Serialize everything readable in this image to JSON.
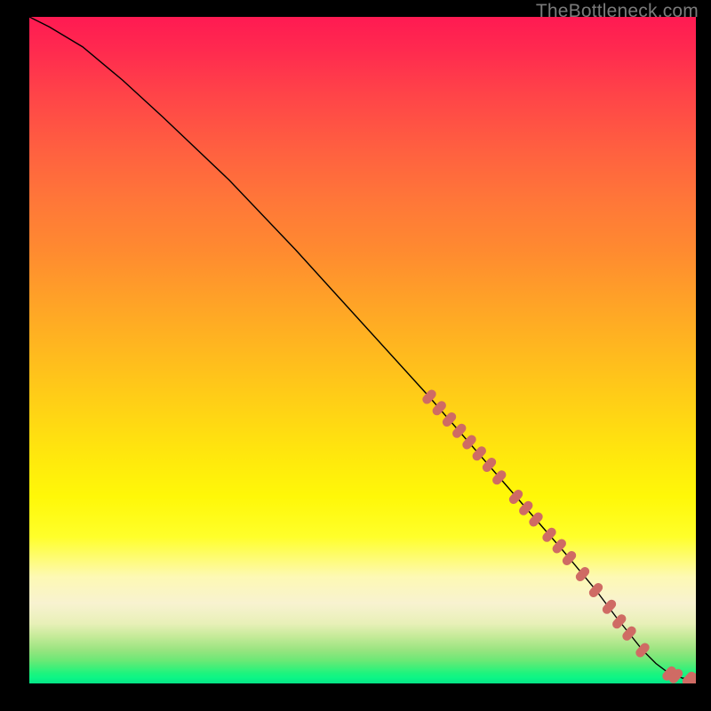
{
  "watermark": "TheBottleneck.com",
  "chart_data": {
    "type": "line",
    "title": "",
    "xlabel": "",
    "ylabel": "",
    "xlim": [
      0,
      100
    ],
    "ylim": [
      0,
      100
    ],
    "series": [
      {
        "name": "curve",
        "color": "#000000",
        "x": [
          0,
          3,
          8,
          14,
          20,
          30,
          40,
          50,
          60,
          70,
          80,
          85,
          88,
          90,
          92,
          94,
          96,
          98,
          100
        ],
        "y": [
          100,
          98.5,
          95.5,
          90.5,
          85,
          75.5,
          65,
          54,
          43,
          31.5,
          20,
          14,
          10,
          7.5,
          5,
          3,
          1.5,
          0.8,
          0.6
        ]
      }
    ],
    "markers": [
      {
        "x": 60,
        "y": 43,
        "color": "#cf6b64"
      },
      {
        "x": 61.5,
        "y": 41.3,
        "color": "#cf6b64"
      },
      {
        "x": 63,
        "y": 39.6,
        "color": "#cf6b64"
      },
      {
        "x": 64.5,
        "y": 37.9,
        "color": "#cf6b64"
      },
      {
        "x": 66,
        "y": 36.2,
        "color": "#cf6b64"
      },
      {
        "x": 67.5,
        "y": 34.5,
        "color": "#cf6b64"
      },
      {
        "x": 69,
        "y": 32.8,
        "color": "#cf6b64"
      },
      {
        "x": 70.5,
        "y": 30.9,
        "color": "#cf6b64"
      },
      {
        "x": 73,
        "y": 28,
        "color": "#cf6b64"
      },
      {
        "x": 74.5,
        "y": 26.3,
        "color": "#cf6b64"
      },
      {
        "x": 76,
        "y": 24.6,
        "color": "#cf6b64"
      },
      {
        "x": 78,
        "y": 22.3,
        "color": "#cf6b64"
      },
      {
        "x": 79.5,
        "y": 20.6,
        "color": "#cf6b64"
      },
      {
        "x": 81,
        "y": 18.8,
        "color": "#cf6b64"
      },
      {
        "x": 83,
        "y": 16.4,
        "color": "#cf6b64"
      },
      {
        "x": 85,
        "y": 14,
        "color": "#cf6b64"
      },
      {
        "x": 87,
        "y": 11.5,
        "color": "#cf6b64"
      },
      {
        "x": 88.5,
        "y": 9.3,
        "color": "#cf6b64"
      },
      {
        "x": 90,
        "y": 7.5,
        "color": "#cf6b64"
      },
      {
        "x": 92,
        "y": 5,
        "color": "#cf6b64"
      },
      {
        "x": 96,
        "y": 1.5,
        "color": "#cf6b64"
      },
      {
        "x": 97,
        "y": 1.1,
        "color": "#cf6b64"
      },
      {
        "x": 99,
        "y": 0.7,
        "color": "#cf6b64"
      },
      {
        "x": 100,
        "y": 0.6,
        "color": "#cf6b64"
      }
    ]
  }
}
